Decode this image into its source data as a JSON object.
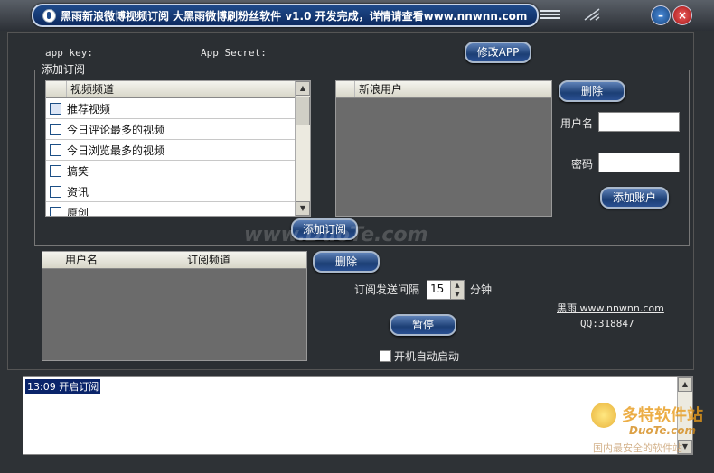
{
  "window": {
    "title": "黑雨新浪微博视频订阅 大黑雨微博刷粉丝软件 v1.0 开发完成，详情请查看www.nnwnn.com",
    "minimize_glyph": "–",
    "close_glyph": "×"
  },
  "config": {
    "app_key_label": "app key:",
    "app_secret_label": "App Secret:",
    "modify_app_button": "修改APP"
  },
  "subscribe_group": {
    "title": "添加订阅",
    "channel_list": {
      "header": "视频频道",
      "items": [
        "推荐视频",
        "今日评论最多的视频",
        "今日浏览最多的视频",
        "搞笑",
        "资讯",
        "原创"
      ]
    },
    "user_list": {
      "header": "新浪用户"
    },
    "delete_button": "删除",
    "username_label": "用户名",
    "password_label": "密码",
    "add_account_button": "添加账户",
    "add_subscription_button": "添加订阅"
  },
  "subscriptions": {
    "col_user": "用户名",
    "col_channel": "订阅频道",
    "delete_button": "删除"
  },
  "controls": {
    "interval_label": "订阅发送间隔",
    "interval_value": "15",
    "interval_unit": "分钟",
    "pause_button": "暂停",
    "autostart_label": "开机自动启动",
    "autostart_checked": false
  },
  "credits": {
    "author_link": "黑雨 www.nnwnn.com",
    "qq": "QQ:318847"
  },
  "log": {
    "lines": [
      "13:09  开启订阅"
    ]
  },
  "watermarks": {
    "center": "www.DuoTe.com",
    "corner_brand": "多特软件站",
    "corner_domain": "DuoTe.com",
    "corner_slogan": "国内最安全的软件站"
  }
}
